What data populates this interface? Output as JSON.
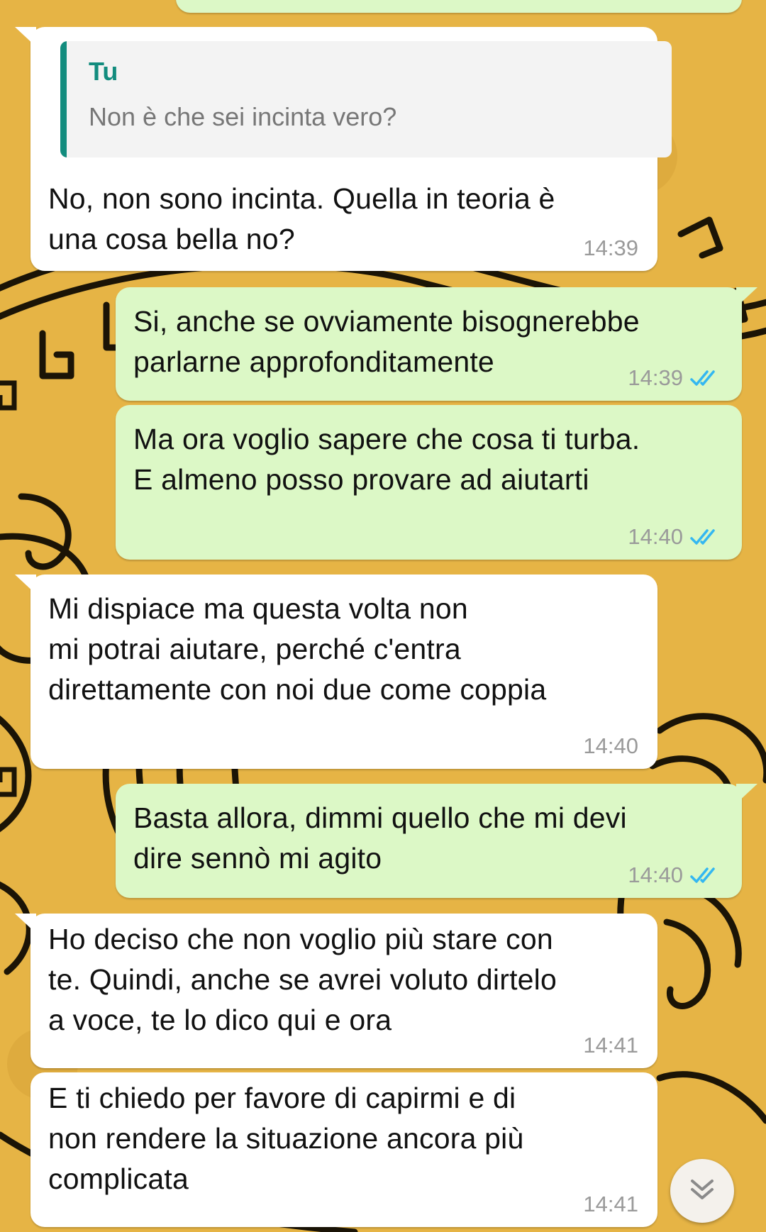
{
  "messages": [
    {
      "id": "m1",
      "direction": "incoming",
      "quote": {
        "author": "Tu",
        "text": "Non è che sei incinta vero?"
      },
      "lines": [
        "No, non sono incinta. Quella in teoria è",
        "una cosa bella no?"
      ],
      "time": "14:39"
    },
    {
      "id": "m2",
      "direction": "outgoing",
      "lines": [
        "Si, anche se ovviamente bisognerebbe",
        "parlarne approfonditamente"
      ],
      "time": "14:39",
      "status": "read"
    },
    {
      "id": "m3",
      "direction": "outgoing",
      "lines": [
        "Ma ora voglio sapere che cosa ti turba.",
        "E almeno posso provare ad aiutarti"
      ],
      "time": "14:40",
      "status": "read"
    },
    {
      "id": "m4",
      "direction": "incoming",
      "lines": [
        "Mi dispiace ma questa volta non",
        "mi potrai aiutare, perché c'entra",
        "direttamente con noi due come coppia"
      ],
      "time": "14:40"
    },
    {
      "id": "m5",
      "direction": "outgoing",
      "lines": [
        "Basta allora, dimmi quello che mi devi",
        "dire sennò mi agito"
      ],
      "time": "14:40",
      "status": "read"
    },
    {
      "id": "m6",
      "direction": "incoming",
      "lines": [
        "Ho deciso che non voglio più stare con",
        "te. Quindi, anche se avrei voluto dirtelo",
        "a voce, te lo dico qui e ora"
      ],
      "time": "14:41"
    },
    {
      "id": "m7",
      "direction": "incoming",
      "lines": [
        "E ti chiedo per favore di capirmi e di",
        "non rendere la situazione ancora più",
        "complicata"
      ],
      "time": "14:41"
    }
  ],
  "colors": {
    "incoming_bubble": "#ffffff",
    "outgoing_bubble": "#dcf8c6",
    "read_ticks": "#34b7f1",
    "quote_accent": "#128c7e",
    "wallpaper": "#e6b445"
  },
  "icons": {
    "read_status": "double-check-icon",
    "scroll_down": "double-chevron-down-icon"
  }
}
